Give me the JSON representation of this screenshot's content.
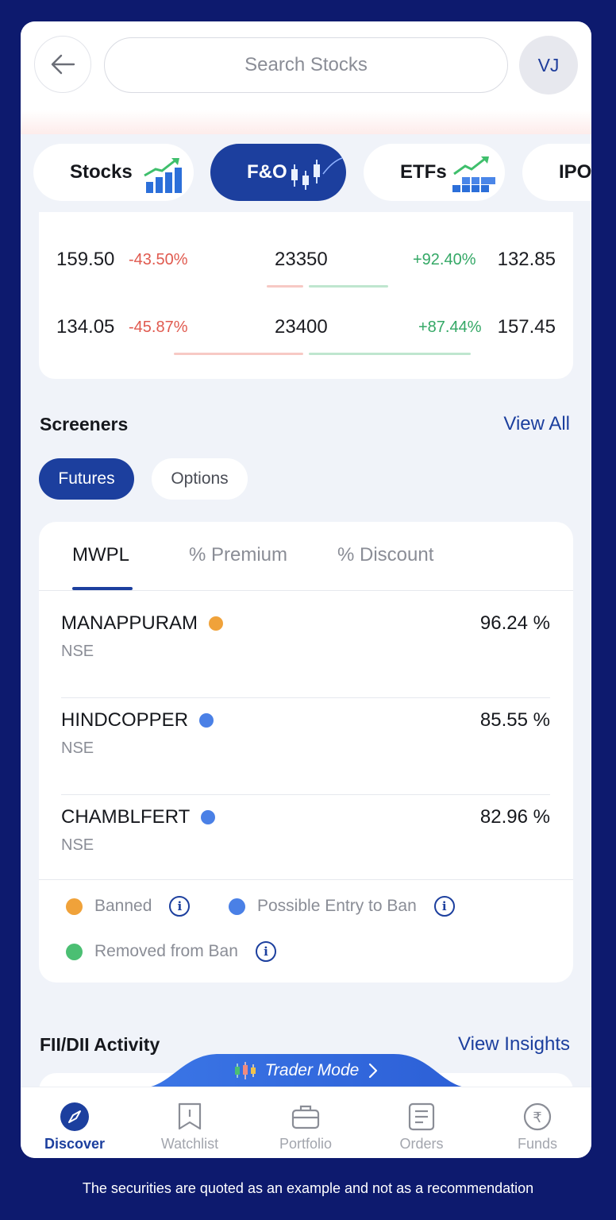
{
  "header": {
    "search_placeholder": "Search Stocks",
    "avatar_initials": "VJ"
  },
  "categories": [
    {
      "label": "Stocks",
      "icon": "bar-chart-up-icon",
      "active": false
    },
    {
      "label": "F&O",
      "icon": "candlestick-icon",
      "active": true
    },
    {
      "label": "ETFs",
      "icon": "stacked-blocks-up-icon",
      "active": false
    },
    {
      "label": "IPO",
      "icon": "",
      "active": false
    }
  ],
  "option_chain": {
    "rows": [
      {
        "call_ltp": "159.50",
        "call_change": "-43.50%",
        "strike": "23350",
        "put_change": "+92.40%",
        "put_ltp": "132.85"
      },
      {
        "call_ltp": "134.05",
        "call_change": "-45.87%",
        "strike": "23400",
        "put_change": "+87.44%",
        "put_ltp": "157.45"
      }
    ]
  },
  "screeners": {
    "title": "Screeners",
    "view_all": "View All",
    "pills": {
      "futures": "Futures",
      "options": "Options"
    },
    "active_pill": "Futures",
    "tabs": [
      "MWPL",
      "% Premium",
      "% Discount"
    ],
    "active_tab": "MWPL",
    "rows": [
      {
        "symbol": "MANAPPURAM",
        "exchange": "NSE",
        "value": "96.24 %",
        "status": "banned"
      },
      {
        "symbol": "HINDCOPPER",
        "exchange": "NSE",
        "value": "85.55 %",
        "status": "possible-entry"
      },
      {
        "symbol": "CHAMBLFERT",
        "exchange": "NSE",
        "value": "82.96 %",
        "status": "possible-entry"
      }
    ],
    "legend": {
      "banned": "Banned",
      "possible_entry": "Possible Entry to Ban",
      "removed": "Removed from Ban",
      "info_glyph": "i"
    },
    "status_colors": {
      "banned": "#f0a23a",
      "possible-entry": "#4a80e6",
      "removed": "#4bbf73"
    }
  },
  "fii": {
    "title": "FII/DII Activity",
    "view_insights": "View Insights"
  },
  "trader_mode": {
    "label": "Trader Mode"
  },
  "nav": {
    "discover": "Discover",
    "watchlist": "Watchlist",
    "portfolio": "Portfolio",
    "orders": "Orders",
    "funds": "Funds",
    "funds_glyph": "₹"
  },
  "disclaimer": "The securities are quoted as an example and not as a recommendation",
  "colors": {
    "accent": "#1c3f9e",
    "negative": "#e05a4f",
    "positive": "#34a866",
    "background": "#0d1a6e"
  }
}
